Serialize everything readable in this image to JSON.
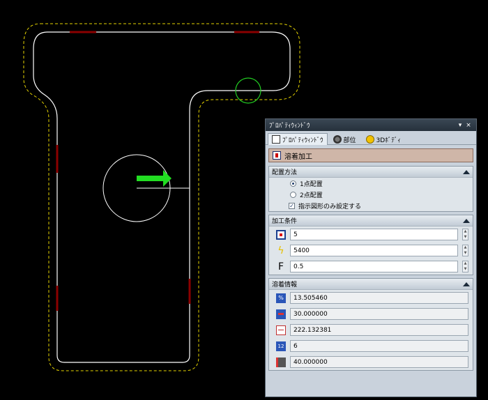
{
  "colors": {
    "background": "#000000",
    "outline": "#ffffff",
    "offset": "#e6d400",
    "marker": "#8b0000",
    "arrow": "#22dd22",
    "circle_marker": "#22cc22"
  },
  "panel": {
    "title": "ﾌﾟﾛﾊﾟﾃｨｳｨﾝﾄﾞｳ",
    "pin_icon": "pin-icon",
    "close_symbol": "×",
    "tabs": [
      {
        "label": "ﾌﾟﾛﾊﾟﾃｨｳｨﾝﾄﾞｳ",
        "icon": "properties-icon",
        "active": true
      },
      {
        "label": "部位",
        "icon": "parts-icon",
        "active": false
      },
      {
        "label": "3Dﾎﾞﾃﾞｨ",
        "icon": "body-icon",
        "active": false
      }
    ],
    "feature": {
      "label": "溶着加工",
      "icon": "weld-icon"
    },
    "placement": {
      "header": "配置方法",
      "options": [
        {
          "label": "1点配置",
          "selected": true
        },
        {
          "label": "2点配置",
          "selected": false
        }
      ],
      "checkbox": {
        "label": "指示図形のみ設定する",
        "checked": true
      }
    },
    "conditions": {
      "header": "加工条件",
      "fields": [
        {
          "icon": "count-icon",
          "value": "5"
        },
        {
          "icon": "lightning-icon",
          "value": "5400"
        },
        {
          "icon": "f-letter-icon",
          "icon_text": "F",
          "value": "0.5"
        }
      ]
    },
    "weld_info": {
      "header": "溶着情報",
      "fields": [
        {
          "icon": "percent-icon",
          "value": "13.505460"
        },
        {
          "icon": "spacing-icon",
          "value": "30.000000"
        },
        {
          "icon": "length-icon",
          "value": "222.132381"
        },
        {
          "icon": "number-icon",
          "value": "6"
        },
        {
          "icon": "height-icon",
          "value": "40.000000"
        }
      ]
    }
  }
}
